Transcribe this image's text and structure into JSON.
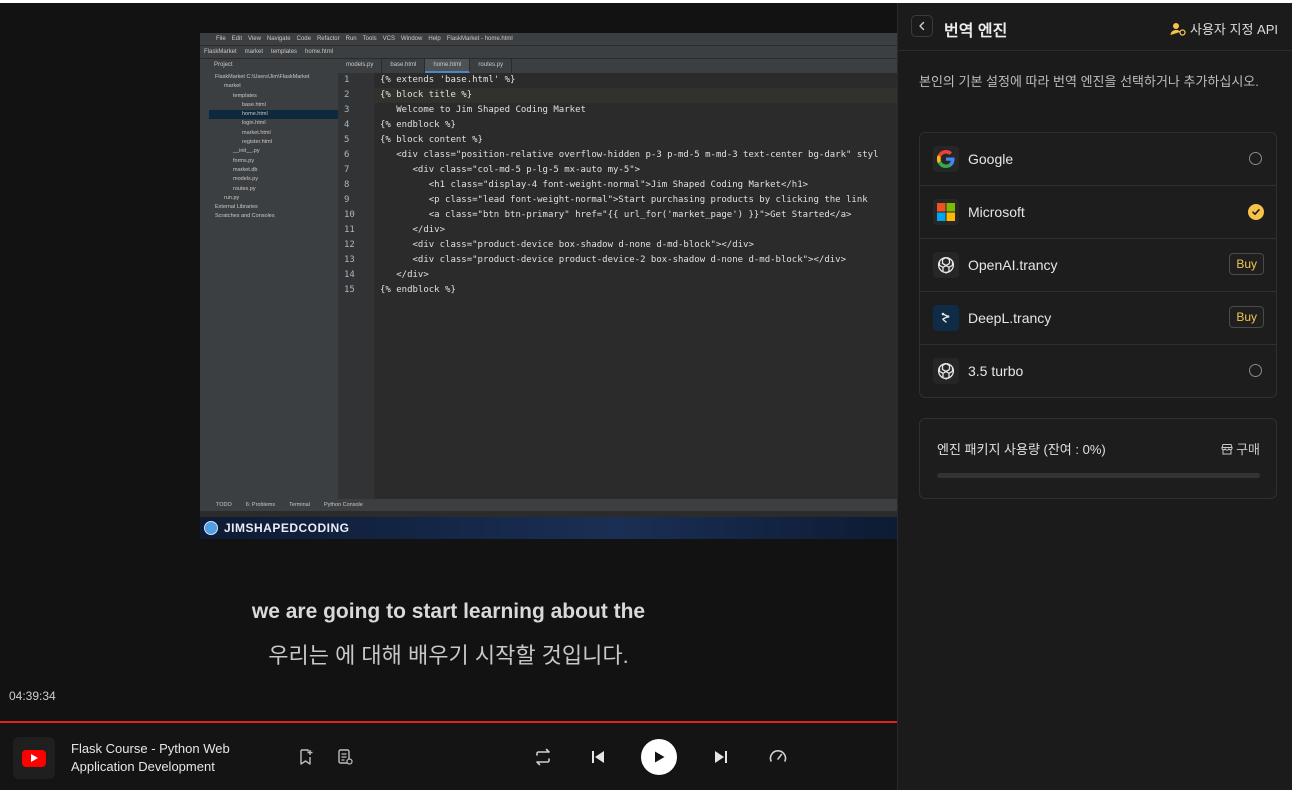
{
  "video": {
    "ide": {
      "menu": [
        "File",
        "Edit",
        "View",
        "Navigate",
        "Code",
        "Refactor",
        "Run",
        "Tools",
        "VCS",
        "Window",
        "Help",
        "FlaskMarket - home.html"
      ],
      "breadcrumbs": [
        "FlaskMarket",
        "market",
        "templates",
        "home.html"
      ],
      "project_label": "Project",
      "tabs": [
        {
          "label": "models.py",
          "active": false
        },
        {
          "label": "base.html",
          "active": false
        },
        {
          "label": "home.html",
          "active": true
        },
        {
          "label": "routes.py",
          "active": false
        }
      ],
      "tree": [
        {
          "label": "FlaskMarket  C:\\Users\\Jim\\FlaskMarket",
          "indent": 0,
          "selected": false
        },
        {
          "label": "market",
          "indent": 1,
          "selected": false
        },
        {
          "label": "templates",
          "indent": 2,
          "selected": false
        },
        {
          "label": "base.html",
          "indent": 3,
          "selected": false
        },
        {
          "label": "home.html",
          "indent": 3,
          "selected": true
        },
        {
          "label": "login.html",
          "indent": 3,
          "selected": false
        },
        {
          "label": "market.html",
          "indent": 3,
          "selected": false
        },
        {
          "label": "register.html",
          "indent": 3,
          "selected": false
        },
        {
          "label": "__init__.py",
          "indent": 2,
          "selected": false
        },
        {
          "label": "forms.py",
          "indent": 2,
          "selected": false
        },
        {
          "label": "market.db",
          "indent": 2,
          "selected": false
        },
        {
          "label": "models.py",
          "indent": 2,
          "selected": false
        },
        {
          "label": "routes.py",
          "indent": 2,
          "selected": false
        },
        {
          "label": "run.py",
          "indent": 1,
          "selected": false
        },
        {
          "label": "External Libraries",
          "indent": 0,
          "selected": false
        },
        {
          "label": "Scratches and Consoles",
          "indent": 0,
          "selected": false
        }
      ],
      "code_lines": [
        {
          "no": "1",
          "text": "{% extends 'base.html' %}",
          "hl": false
        },
        {
          "no": "2",
          "text": "{% block title %}",
          "hl": true
        },
        {
          "no": "3",
          "text": "   Welcome to Jim Shaped Coding Market",
          "hl": false
        },
        {
          "no": "4",
          "text": "{% endblock %}",
          "hl": false
        },
        {
          "no": "5",
          "text": "{% block content %}",
          "hl": false
        },
        {
          "no": "6",
          "text": "   <div class=\"position-relative overflow-hidden p-3 p-md-5 m-md-3 text-center bg-dark\" styl",
          "hl": false
        },
        {
          "no": "7",
          "text": "      <div class=\"col-md-5 p-lg-5 mx-auto my-5\">",
          "hl": false
        },
        {
          "no": "8",
          "text": "         <h1 class=\"display-4 font-weight-normal\">Jim Shaped Coding Market</h1>",
          "hl": false
        },
        {
          "no": "9",
          "text": "         <p class=\"lead font-weight-normal\">Start purchasing products by clicking the link",
          "hl": false
        },
        {
          "no": "10",
          "text": "         <a class=\"btn btn-primary\" href=\"{{ url_for('market_page') }}\">Get Started</a>",
          "hl": false
        },
        {
          "no": "11",
          "text": "      </div>",
          "hl": false
        },
        {
          "no": "12",
          "text": "      <div class=\"product-device box-shadow d-none d-md-block\"></div>",
          "hl": false
        },
        {
          "no": "13",
          "text": "      <div class=\"product-device product-device-2 box-shadow d-none d-md-block\"></div>",
          "hl": false
        },
        {
          "no": "14",
          "text": "   </div>",
          "hl": false
        },
        {
          "no": "15",
          "text": "{% endblock %}",
          "hl": false
        }
      ],
      "bottom_tabs": [
        "TODO",
        "6: Problems",
        "Terminal",
        "Python Console"
      ],
      "banner_text": "JIMSHAPEDCODING"
    },
    "subtitle_en": "we are going to start learning about the",
    "subtitle_ko": "우리는 에 대해 배우기 시작할 것입니다.",
    "timestamp": "04:39:34",
    "progress_fraction": 1.0
  },
  "player": {
    "title": "Flask Course - Python Web Application Development",
    "icons": [
      "youtube-icon",
      "add-bookmark-icon",
      "transcript-icon",
      "loop-icon",
      "previous-icon",
      "play-icon",
      "next-icon",
      "speed-icon"
    ]
  },
  "panel": {
    "title": "번역 엔진",
    "custom_api_label": "사용자 지정 API",
    "description": "본인의 기본 설정에 따라 번역 엔진을 선택하거나 추가하십시오.",
    "engines": [
      {
        "name": "Google",
        "state": "radio",
        "icon": "google-icon"
      },
      {
        "name": "Microsoft",
        "state": "selected",
        "icon": "microsoft-icon"
      },
      {
        "name": "OpenAI.trancy",
        "state": "buy",
        "icon": "openai-icon"
      },
      {
        "name": "DeepL.trancy",
        "state": "buy",
        "icon": "deepl-icon"
      },
      {
        "name": "3.5 turbo",
        "state": "radio",
        "icon": "openai-icon"
      }
    ],
    "buy_label": "Buy",
    "usage_label": "엔진 패키지 사용량 (잔여 : 0%)",
    "usage_buy_label": "구매",
    "usage_fraction": 0.0
  },
  "colors": {
    "accent": "#f5c34a",
    "progress": "#e0241b",
    "panel_bg": "#1b1b1b",
    "youtube_red": "#ff0000"
  }
}
